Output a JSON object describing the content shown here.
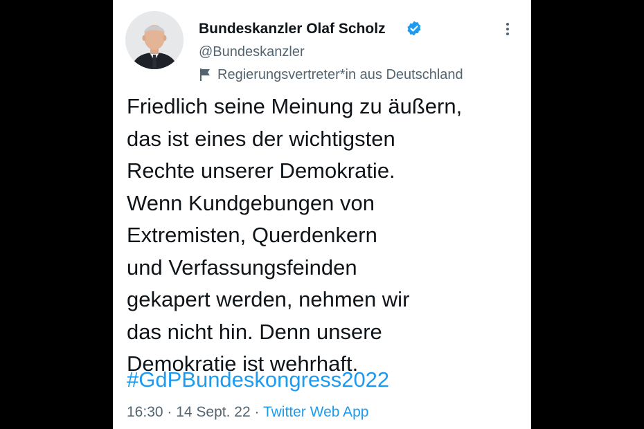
{
  "tweet": {
    "author": {
      "display_name": "Bundeskanzler Olaf Scholz",
      "handle": "@Bundeskanzler",
      "verified": true,
      "label": "Regierungsvertreter*in aus Deutschland",
      "avatar_icon": "avatar-photo"
    },
    "text": "Friedlich seine Meinung zu äußern,\ndas ist eines der wichtigsten\nRechte unserer Demokratie.\nWenn Kundgebungen von\nExtremisten, Querdenkern\nund Verfassungsfeinden\ngekapert werden, nehmen wir\ndas nicht hin. Denn unsere\nDemokratie ist wehrhaft.",
    "hashtag": "#GdPBundeskongress2022",
    "meta": {
      "time": "16:30",
      "separator": " · ",
      "date": "14 Sept. 22",
      "source": "Twitter Web App"
    }
  },
  "icons": {
    "verified": "verified-badge-icon",
    "more": "more-options-icon",
    "label": "flag-icon"
  },
  "colors": {
    "background": "#000000",
    "card": "#ffffff",
    "text_primary": "#0f1419",
    "text_secondary": "#536471",
    "accent": "#1d9bf0"
  }
}
